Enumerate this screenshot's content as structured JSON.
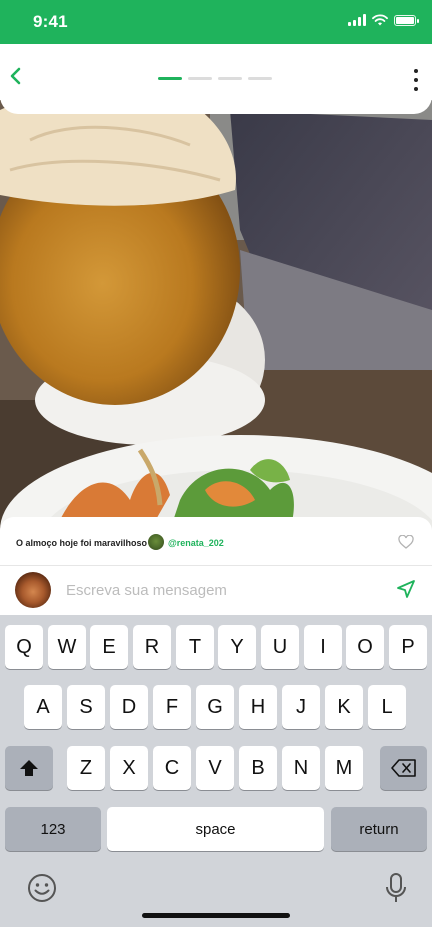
{
  "status_bar": {
    "time": "9:41"
  },
  "header": {
    "back_icon": "chevron-left-icon",
    "progress": {
      "total": 4,
      "active_index": 0
    },
    "menu_icon": "more-vertical-icon"
  },
  "photo": {
    "description_icon": "food-photo"
  },
  "caption": {
    "text": "O almoço hoje foi maravilhoso",
    "handle": "@renata_202",
    "like_icon": "heart-outline-icon"
  },
  "composer": {
    "placeholder": "Escreva sua mensagem",
    "send_icon": "send-icon"
  },
  "keyboard": {
    "row1": [
      "Q",
      "W",
      "E",
      "R",
      "T",
      "Y",
      "U",
      "I",
      "O",
      "P"
    ],
    "row2": [
      "A",
      "S",
      "D",
      "F",
      "G",
      "H",
      "J",
      "K",
      "L"
    ],
    "row3": [
      "Z",
      "X",
      "C",
      "V",
      "B",
      "N",
      "M"
    ],
    "numbers_label": "123",
    "space_label": "space",
    "return_label": "return"
  },
  "colors": {
    "accent": "#1fb35c",
    "keyboard_bg": "#d1d4d9"
  }
}
